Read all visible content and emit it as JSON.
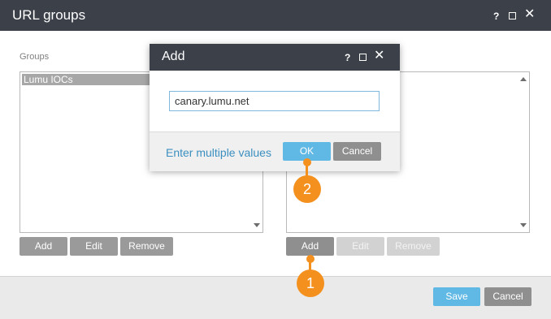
{
  "outer_window": {
    "title": "URL groups",
    "help_glyph": "?",
    "close_glyph": "✕"
  },
  "groups": {
    "label": "Groups",
    "items": [
      "Lumu IOCs"
    ],
    "buttons": {
      "add": "Add",
      "edit": "Edit",
      "remove": "Remove"
    }
  },
  "urls": {
    "buttons": {
      "add": "Add",
      "edit": "Edit",
      "remove": "Remove"
    }
  },
  "footer": {
    "save": "Save",
    "cancel": "Cancel"
  },
  "add_dialog": {
    "title": "Add",
    "help_glyph": "?",
    "close_glyph": "✕",
    "input_value": "canary.lumu.net",
    "enter_multiple_link": "Enter multiple values",
    "ok": "OK",
    "cancel": "Cancel"
  },
  "callouts": {
    "step1": "1",
    "step2": "2"
  },
  "colors": {
    "titlebar": "#3b4049",
    "accent_blue": "#60b8e4",
    "callout_orange": "#f4901e"
  },
  "icons": [
    "help-icon",
    "maximize-icon",
    "close-icon",
    "scroll-up-icon",
    "scroll-down-icon"
  ]
}
